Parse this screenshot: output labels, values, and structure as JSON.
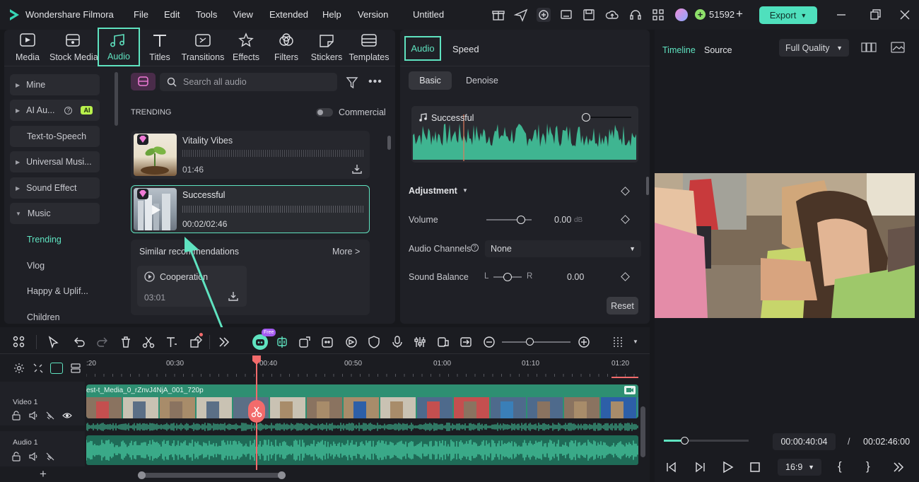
{
  "app": {
    "name": "Wondershare Filmora",
    "project_title": "Untitled"
  },
  "menu": [
    "File",
    "Edit",
    "Tools",
    "View",
    "Extended",
    "Help",
    "Version"
  ],
  "header": {
    "credits": "51592",
    "export_label": "Export"
  },
  "media_tabs": [
    {
      "label": "Media",
      "icon": "media-icon"
    },
    {
      "label": "Stock Media",
      "icon": "stock-media-icon"
    },
    {
      "label": "Audio",
      "icon": "music-note-icon",
      "active": true
    },
    {
      "label": "Titles",
      "icon": "titles-icon"
    },
    {
      "label": "Transitions",
      "icon": "transitions-icon"
    },
    {
      "label": "Effects",
      "icon": "effects-icon"
    },
    {
      "label": "Filters",
      "icon": "filters-icon"
    },
    {
      "label": "Stickers",
      "icon": "stickers-icon"
    },
    {
      "label": "Templates",
      "icon": "templates-icon"
    }
  ],
  "sidebar": {
    "items": [
      {
        "label": "Mine"
      },
      {
        "label": "AI Au...",
        "badge": "AI"
      },
      {
        "label": "Text-to-Speech"
      },
      {
        "label": "Universal Musi..."
      },
      {
        "label": "Sound Effect"
      },
      {
        "label": "Music"
      },
      {
        "label": "Trending"
      },
      {
        "label": "Vlog"
      },
      {
        "label": "Happy & Uplif..."
      },
      {
        "label": "Children"
      }
    ]
  },
  "audio_library": {
    "search_placeholder": "Search all audio",
    "section_title": "TRENDING",
    "commercial_label": "Commercial",
    "tracks": [
      {
        "title": "Vitality Vibes",
        "duration": "01:46"
      },
      {
        "title": "Successful",
        "duration": "00:02/02:46"
      }
    ],
    "similar_title": "Similar recommendations",
    "more_label": "More >",
    "recommendation": {
      "title": "Cooperation",
      "duration": "03:01"
    }
  },
  "properties": {
    "tabs": [
      "Audio",
      "Speed"
    ],
    "subtabs": [
      "Basic",
      "Denoise"
    ],
    "track_name": "Successful",
    "adjustment_label": "Adjustment",
    "volume_label": "Volume",
    "volume_value": "0.00",
    "volume_unit": "dB",
    "channels_label": "Audio Channels",
    "channels_value": "None",
    "balance_label": "Sound Balance",
    "balance_left": "L",
    "balance_right": "R",
    "balance_value": "0.00",
    "reset_label": "Reset"
  },
  "preview": {
    "tabs": [
      "Timeline",
      "Source"
    ],
    "quality": "Full Quality",
    "current_time": "00:00:40:04",
    "separator": "/",
    "total_time": "00:02:46:00",
    "aspect": "16:9",
    "progress": 0.24
  },
  "timeline": {
    "ruler_labels": [
      ":20",
      "00:30",
      "00:40",
      "00:50",
      "01:00",
      "01:10",
      "01:20"
    ],
    "video_track": "Video 1",
    "audio_track": "Audio 1",
    "clip_name": "est-t_Media_0_rZnvJ4NjA_001_720p",
    "free_badge": "Free"
  },
  "colors": {
    "accent": "#5fe3c0",
    "playhead": "#f26b6b",
    "clip": "#2e8f72",
    "export": "#4fe0bd"
  }
}
